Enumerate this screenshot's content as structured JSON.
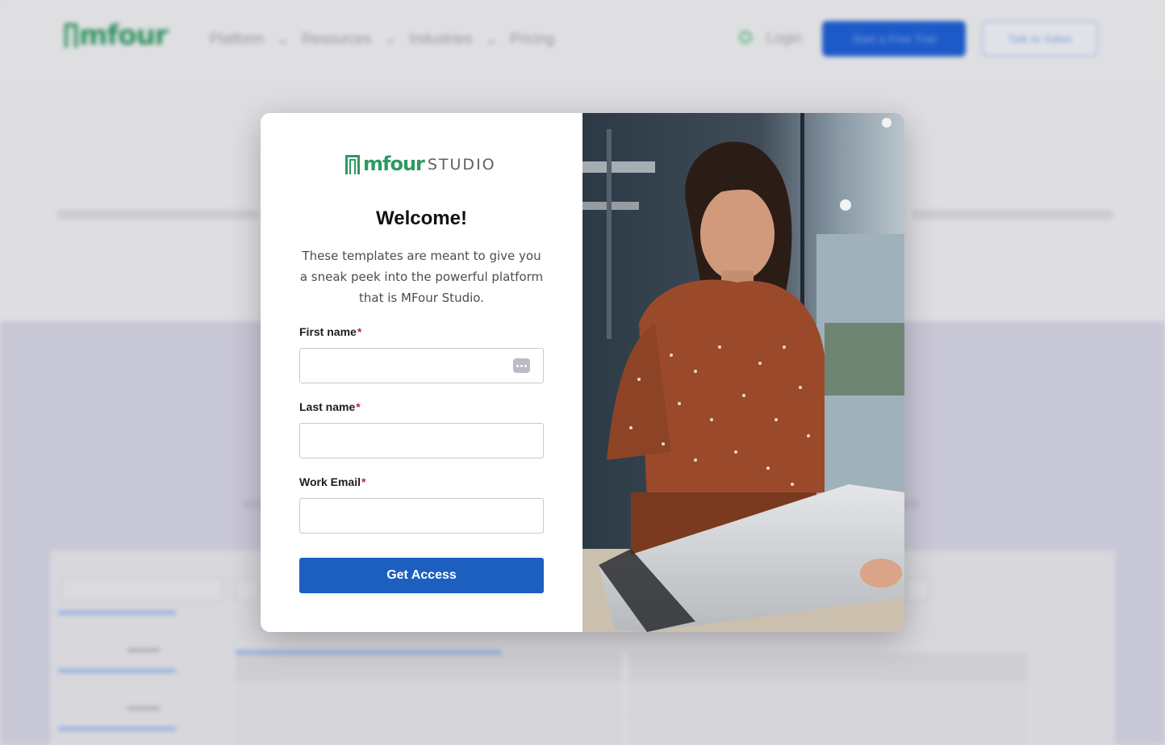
{
  "background_page": {
    "logo": "mfour",
    "nav": [
      "Platform",
      "Resources",
      "Industries",
      "Pricing"
    ],
    "login": "Login",
    "cta_primary": "Start a Free Trial",
    "cta_secondary": "Talk to Sales"
  },
  "modal": {
    "brand_name": "mfour",
    "brand_sub": "STUDIO",
    "title": "Welcome!",
    "description": "These templates are meant to give you a sneak peek into the powerful platform that is MFour Studio.",
    "fields": {
      "first_name_label": "First name",
      "last_name_label": "Last name",
      "email_label": "Work Email",
      "required_mark": "*"
    },
    "submit_label": "Get Access"
  },
  "colors": {
    "brand_green": "#2e9a5f",
    "button_blue": "#1c5fbe",
    "required_red": "#c2272d"
  }
}
